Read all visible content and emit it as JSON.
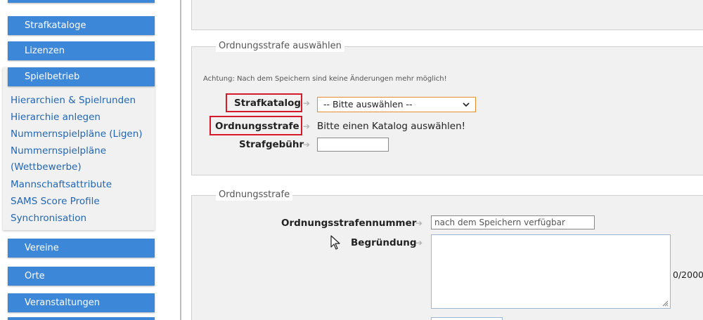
{
  "sidebar": {
    "buttons_top": [
      {
        "label": "Strafkataloge"
      },
      {
        "label": "Lizenzen"
      },
      {
        "label": "Spielbetrieb"
      }
    ],
    "sublinks": [
      {
        "label": "Hierarchien & Spielrunden"
      },
      {
        "label": "Hierarchie anlegen"
      },
      {
        "label": "Nummernspielpläne (Ligen)"
      },
      {
        "label": "Nummernspielpläne"
      },
      {
        "label": "(Wettbewerbe)"
      },
      {
        "label": "Mannschaftsattribute"
      },
      {
        "label": "SAMS Score Profile"
      },
      {
        "label": "Synchronisation"
      }
    ],
    "buttons_bottom": [
      {
        "label": "Vereine"
      },
      {
        "label": "Orte"
      },
      {
        "label": "Veranstaltungen"
      }
    ]
  },
  "section_select": {
    "legend": "Ordnungsstrafe auswählen",
    "notice": "Achtung: Nach dem Speichern sind keine Änderungen mehr möglich!",
    "strafkatalog_label": "Strafkatalog",
    "strafkatalog_value": "-- Bitte auswählen --",
    "ordnungsstrafe_label": "Ordnungsstrafe",
    "ordnungsstrafe_hint": "Bitte einen Katalog auswählen!",
    "strafgebuehr_label": "Strafgebühr",
    "strafgebuehr_value": ""
  },
  "section_detail": {
    "legend": "Ordnungsstrafe",
    "nummer_label": "Ordnungsstrafennummer",
    "nummer_value": "nach dem Speichern verfügbar",
    "begruendung_label": "Begründung",
    "begruendung_counter": "0/2000"
  },
  "colors": {
    "nav_button": "#3d87d9",
    "link": "#2066b5",
    "highlight": "#d6192b",
    "select_border": "#e98c2e"
  },
  "icons": {
    "arrow": "arrow-right-icon",
    "chevron": "chevron-down-icon",
    "cursor": "mouse-pointer-icon",
    "resize": "resize-handle-icon"
  }
}
